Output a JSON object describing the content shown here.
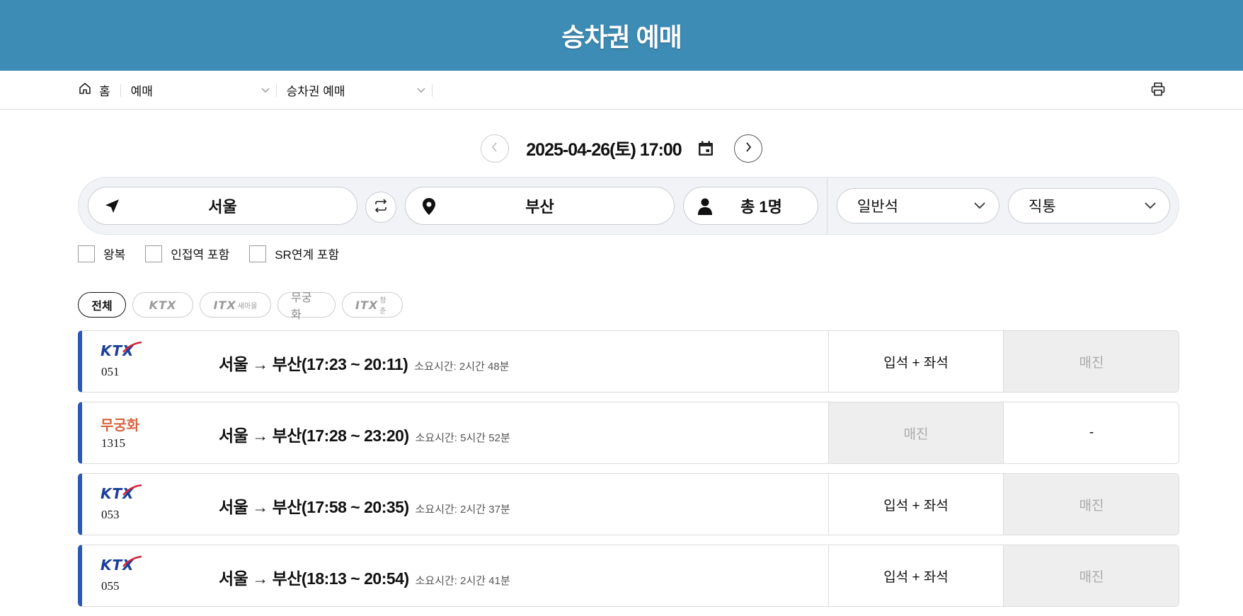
{
  "header": {
    "title": "승차권 예매"
  },
  "breadcrumb": {
    "home": "홈",
    "level1": "예매",
    "level2": "승차권 예매"
  },
  "date": {
    "display": "2025-04-26(토) 17:00"
  },
  "search": {
    "departure": "서울",
    "arrival": "부산",
    "passengers": "총 1명",
    "seat_class": "일반석",
    "route_type": "직통"
  },
  "options": {
    "round_trip": "왕복",
    "nearby": "인접역 포함",
    "sr": "SR연계 포함"
  },
  "filters": {
    "all": "전체",
    "ktx": "KTX",
    "itx_saemaeul_logo": "ITX",
    "itx_saemaeul_sub": "새마을",
    "mugunghwa": "무궁화",
    "itx_cheongchun_logo": "ITX",
    "itx_cheongchun_sub": "청춘"
  },
  "trains": [
    {
      "type": "KTX",
      "number": "051",
      "route": "서울 → 부산(17:23 ~ 20:11)",
      "duration": "소요시간: 2시간 48분",
      "col1": "입석 + 좌석",
      "col1_sold": false,
      "col2": "매진",
      "col2_sold": true
    },
    {
      "type": "무궁화",
      "number": "1315",
      "route": "서울 → 부산(17:28 ~ 23:20)",
      "duration": "소요시간: 5시간 52분",
      "col1": "매진",
      "col1_sold": true,
      "col2": "-",
      "col2_sold": false
    },
    {
      "type": "KTX",
      "number": "053",
      "route": "서울 → 부산(17:58 ~ 20:35)",
      "duration": "소요시간: 2시간 37분",
      "col1": "입석 + 좌석",
      "col1_sold": false,
      "col2": "매진",
      "col2_sold": true
    },
    {
      "type": "KTX",
      "number": "055",
      "route": "서울 → 부산(18:13 ~ 20:54)",
      "duration": "소요시간: 2시간 41분",
      "col1": "입석 + 좌석",
      "col1_sold": false,
      "col2": "매진",
      "col2_sold": true
    }
  ],
  "colors": {
    "header_bg": "#3d8cb5",
    "row_accent": "#2a58b5",
    "ktx_logo": "#1b3f98",
    "mugunghwa_logo": "#d8653f",
    "sold_bg": "#eeeeee"
  }
}
